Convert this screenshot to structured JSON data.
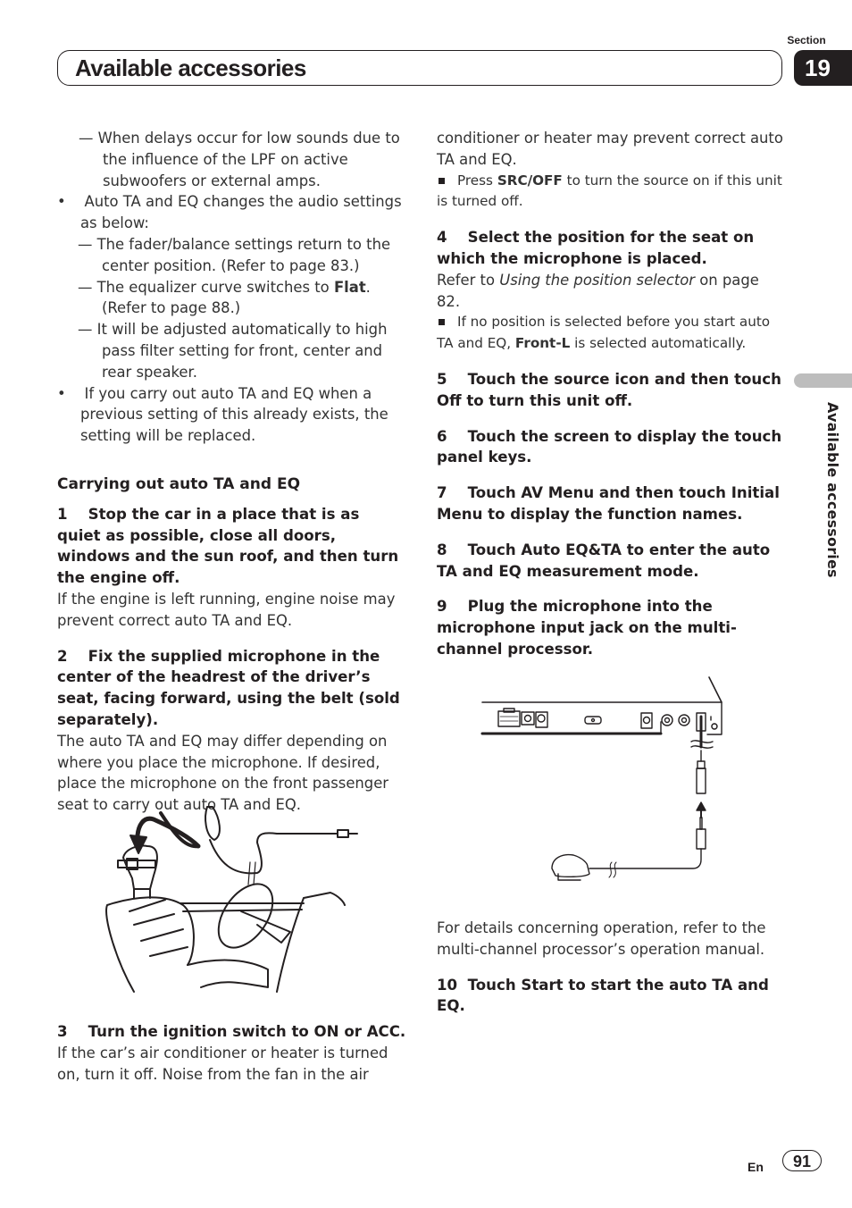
{
  "header": {
    "section_label": "Section",
    "section_number": "19",
    "title": "Available accessories"
  },
  "side_tab": {
    "label": "Available accessories"
  },
  "left_column": {
    "intro_dash_1": "When delays occur for low sounds due to the influence of the LPF on active subwoofers or external amps.",
    "bullet_1": "Auto TA and EQ changes the audio settings as below:",
    "bullet_1_dashes": [
      "The fader/balance settings return to the center position. (Refer to page 83.)",
      "The equalizer curve switches to ",
      "It will be adjusted automatically to high pass filter setting for front, center and rear speaker."
    ],
    "flat_bold": "Flat",
    "flat_suffix": ". (Refer to page 88.)",
    "bullet_2": "If you carry out auto TA and EQ when a previous setting of this already exists, the setting will be replaced.",
    "heading": "Carrying out auto TA and EQ",
    "step_1_num": "1",
    "step_1": "Stop the car in a place that is as quiet as possible, close all doors, windows and the sun roof, and then turn the engine off.",
    "step_1_body": "If the engine is left running, engine noise may prevent correct auto TA and EQ.",
    "step_2_num": "2",
    "step_2": "Fix the supplied microphone in the center of the headrest of the driver’s seat, facing forward, using the belt (sold separately).",
    "step_2_body": "The auto TA and EQ may differ depending on where you place the microphone. If desired, place the microphone on the front passenger seat to carry out auto TA and EQ.",
    "step_3_num": "3",
    "step_3": "Turn the ignition switch to ON or ACC.",
    "step_3_body": "If the car’s air conditioner or heater is turned on, turn it off. Noise from the fan in the air"
  },
  "right_column": {
    "cont_body": "conditioner or heater may prevent correct auto TA and EQ.",
    "note_1_prefix": "Press ",
    "note_1_bold": "SRC/OFF",
    "note_1_suffix": " to turn the source on if this unit is turned off.",
    "step_4_num": "4",
    "step_4": "Select the position for the seat on which the microphone is placed.",
    "step_4_body_prefix": "Refer to ",
    "step_4_body_italic": "Using the position selector",
    "step_4_body_suffix": " on page 82.",
    "note_2_prefix": "If no position is selected before you start auto TA and EQ, ",
    "note_2_bold": "Front-L",
    "note_2_suffix": " is selected automatically.",
    "step_5_num": "5",
    "step_5": "Touch the source icon and then touch Off to turn this unit off.",
    "step_6_num": "6",
    "step_6": "Touch the screen to display the touch panel keys.",
    "step_7_num": "7",
    "step_7": "Touch AV Menu and then touch Initial Menu to display the function names.",
    "step_8_num": "8",
    "step_8": "Touch Auto EQ&TA to enter the auto TA and EQ measurement mode.",
    "step_9_num": "9",
    "step_9": "Plug the microphone into the microphone input jack on the multi-channel processor.",
    "details_body": "For details concerning operation, refer to the multi-channel processor’s operation manual.",
    "step_10_num": "10",
    "step_10": "Touch Start to start the auto TA and EQ."
  },
  "footer": {
    "lang": "En",
    "page": "91"
  }
}
